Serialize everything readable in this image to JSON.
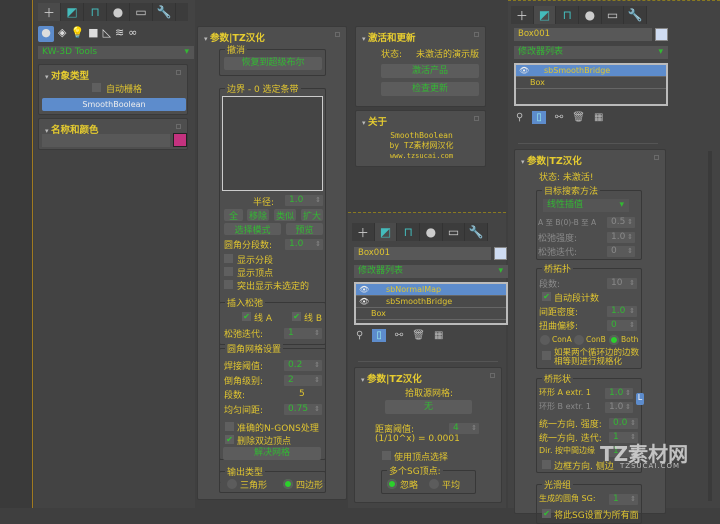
{
  "create_panel": {
    "tabs": [
      "create",
      "modify",
      "hierarchy",
      "motion",
      "display",
      "utilities"
    ],
    "categories": [
      "geometry",
      "shapes",
      "lights",
      "cameras",
      "helpers",
      "space-warps",
      "systems"
    ],
    "category_dropdown": "KW-3D Tools",
    "object_type": {
      "title": "对象类型",
      "autogrid": "自动栅格",
      "button": "SmoothBoolean"
    },
    "name_color": {
      "title": "名称和颜色",
      "name_value": "",
      "color": "#c4327f"
    }
  },
  "sb_params": {
    "title": "参数|TZ汉化",
    "undo_group": "撤消",
    "restore_button": "恢复到超级布尔",
    "border_group": "边界 - 0 选定条带",
    "radius_label": "半径:",
    "radius_value": "1.0",
    "btn_all": "全",
    "btn_remove": "移除",
    "btn_similar": "类似",
    "btn_grow": "扩大",
    "btn_select_mode": "选择模式",
    "btn_preview": "预览",
    "fillet_segs_label": "圆角分段数:",
    "fillet_segs_value": "1.0",
    "show_segs": "显示分段",
    "show_verts": "显示顶点",
    "highlight_unselected": "突出显示未选定的",
    "insert_relax": {
      "title": "插入松弛",
      "line_a": "线 A",
      "line_b": "线 B",
      "iter_label": "松弛迭代:",
      "iter_value": "1"
    },
    "mesh": {
      "title": "圆角网格设置",
      "weld_label": "焊接阈值:",
      "weld_value": "0.2",
      "chamfer_label": "倒角级别:",
      "chamfer_value": "2",
      "segs_label": "段数:",
      "segs_value": "5",
      "spacing_label": "均匀间距:",
      "spacing_value": "0.75",
      "ngons": "准确的N-GONS处理",
      "remove_verts": "删除双边顶点",
      "solve_button": "解决网格"
    },
    "output": {
      "title": "输出类型",
      "tri": "三角形",
      "quad": "四边形",
      "selected": "quad"
    }
  },
  "activation": {
    "title": "激活和更新",
    "status_label": "状态:",
    "status_value": "未激活的演示版",
    "activate_button": "激活产品",
    "update_button": "检查更新"
  },
  "about": {
    "title": "关于",
    "line1": "SmoothBoolean",
    "line2": "by TZ素材网汉化",
    "line3": "www.tzsucai.com"
  },
  "float_panel": {
    "object_name": "Box001",
    "modifier_list": "修改器列表",
    "stack": [
      "sbNormalMap",
      "sbSmoothBridge",
      "Box"
    ],
    "params_title": "参数|TZ汉化",
    "pick_label": "拾取源网格:",
    "pick_button": "无",
    "dist_label": "距离阈值:",
    "dist_value": "4",
    "formula": "(1/10^x) = 0.0001",
    "use_vert_sel": "使用顶点选择",
    "sg_group": "多个SG顶点:",
    "ignore": "忽略",
    "average": "平均",
    "sg_selected": "ignore"
  },
  "right_panel": {
    "object_name": "Box001",
    "modifier_list": "修改器列表",
    "stack": [
      "sbSmoothBridge",
      "Box"
    ],
    "params_title": "参数|TZ汉化",
    "status": "状态: 未激活!",
    "target": {
      "title": "目标搜索方法",
      "method": "线性插值",
      "ab_label": "A 至 B(0)-B 至 A",
      "ab_value": "0.5",
      "relax_str_label": "松弛强度:",
      "relax_str_value": "1.0",
      "relax_iter_label": "松弛迭代:",
      "relax_iter_value": "0"
    },
    "bridge": {
      "title": "桥拓扑",
      "segs_label": "段数:",
      "segs_value": "10",
      "auto_segs": "自动段计数",
      "spacing_label": "间距密度:",
      "spacing_value": "1.0",
      "twist_label": "扭曲偏移:",
      "twist_value": "0",
      "con_a": "ConA",
      "con_b": "ConB",
      "both": "Both",
      "con_selected": "Both",
      "normalize": "如果两个循环边的边数相等则进行规格化"
    },
    "shape": {
      "title": "桥形状",
      "ring_a_label": "环形 A extr. 1",
      "ring_a_value": "1.0",
      "ring_b_label": "环形 B extr. 1",
      "ring_b_value": "1.0",
      "lock": "L",
      "uni_str_label": "统一方向. 强度:",
      "uni_str_value": "0.0",
      "uni_iter_label": "统一方向. 迭代:",
      "uni_iter_value": "1",
      "dir_label": "Dir. 按中間边缘",
      "dir_value": "1",
      "border_dir": "边框方向. 侧边"
    },
    "smooth": {
      "title": "光滑组",
      "gen_label": "生成的圆角 SG:",
      "gen_value": "1",
      "set_label": "将此SG设置为所有面"
    }
  },
  "watermark": {
    "text": "TZ素材网",
    "url": "TZSUCAI.COM"
  }
}
